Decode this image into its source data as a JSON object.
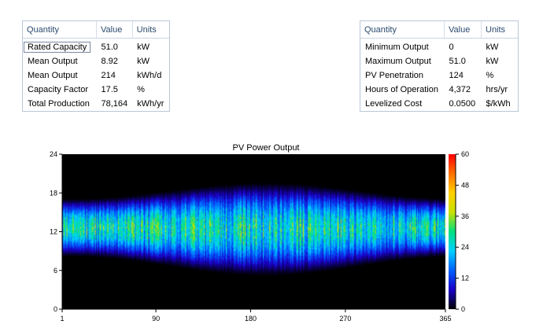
{
  "left_table": {
    "headers": [
      "Quantity",
      "Value",
      "Units"
    ],
    "rows": [
      {
        "quantity": "Rated Capacity",
        "value": "51.0",
        "units": "kW"
      },
      {
        "quantity": "Mean Output",
        "value": "8.92",
        "units": "kW"
      },
      {
        "quantity": "Mean Output",
        "value": "214",
        "units": "kWh/d"
      },
      {
        "quantity": "Capacity Factor",
        "value": "17.5",
        "units": "%"
      },
      {
        "quantity": "Total Production",
        "value": "78,164",
        "units": "kWh/yr"
      }
    ]
  },
  "right_table": {
    "headers": [
      "Quantity",
      "Value",
      "Units"
    ],
    "rows": [
      {
        "quantity": "Minimum Output",
        "value": "0",
        "units": "kW"
      },
      {
        "quantity": "Maximum Output",
        "value": "51.0",
        "units": "kW"
      },
      {
        "quantity": "PV Penetration",
        "value": "124",
        "units": "%"
      },
      {
        "quantity": "Hours of Operation",
        "value": "4,372",
        "units": "hrs/yr"
      },
      {
        "quantity": "Levelized Cost",
        "value": "0.0500",
        "units": "$/kWh"
      }
    ]
  },
  "chart_data": {
    "type": "heatmap",
    "title": "PV Power Output",
    "xlabel": "",
    "ylabel": "",
    "x_ticks": [
      "1",
      "90",
      "180",
      "270",
      "365"
    ],
    "y_ticks": [
      "0",
      "6",
      "12",
      "18",
      "24"
    ],
    "colorbar_ticks": [
      "0",
      "12",
      "24",
      "36",
      "48",
      "60"
    ],
    "xlim": [
      1,
      365
    ],
    "ylim": [
      0,
      24
    ],
    "colorbar_range": [
      0,
      60
    ],
    "colormap": [
      "#000000",
      "#1a00c8",
      "#0060ff",
      "#00d0ff",
      "#00e080",
      "#c8e000",
      "#ffd000",
      "#ff7000",
      "#ff0000"
    ],
    "daylight_hours": {
      "winter": {
        "sunrise": 8,
        "sunset": 17
      },
      "summer": {
        "sunrise": 5,
        "sunset": 19.5
      }
    },
    "peak_hour": 12.5,
    "peak_output_kw": 36
  }
}
